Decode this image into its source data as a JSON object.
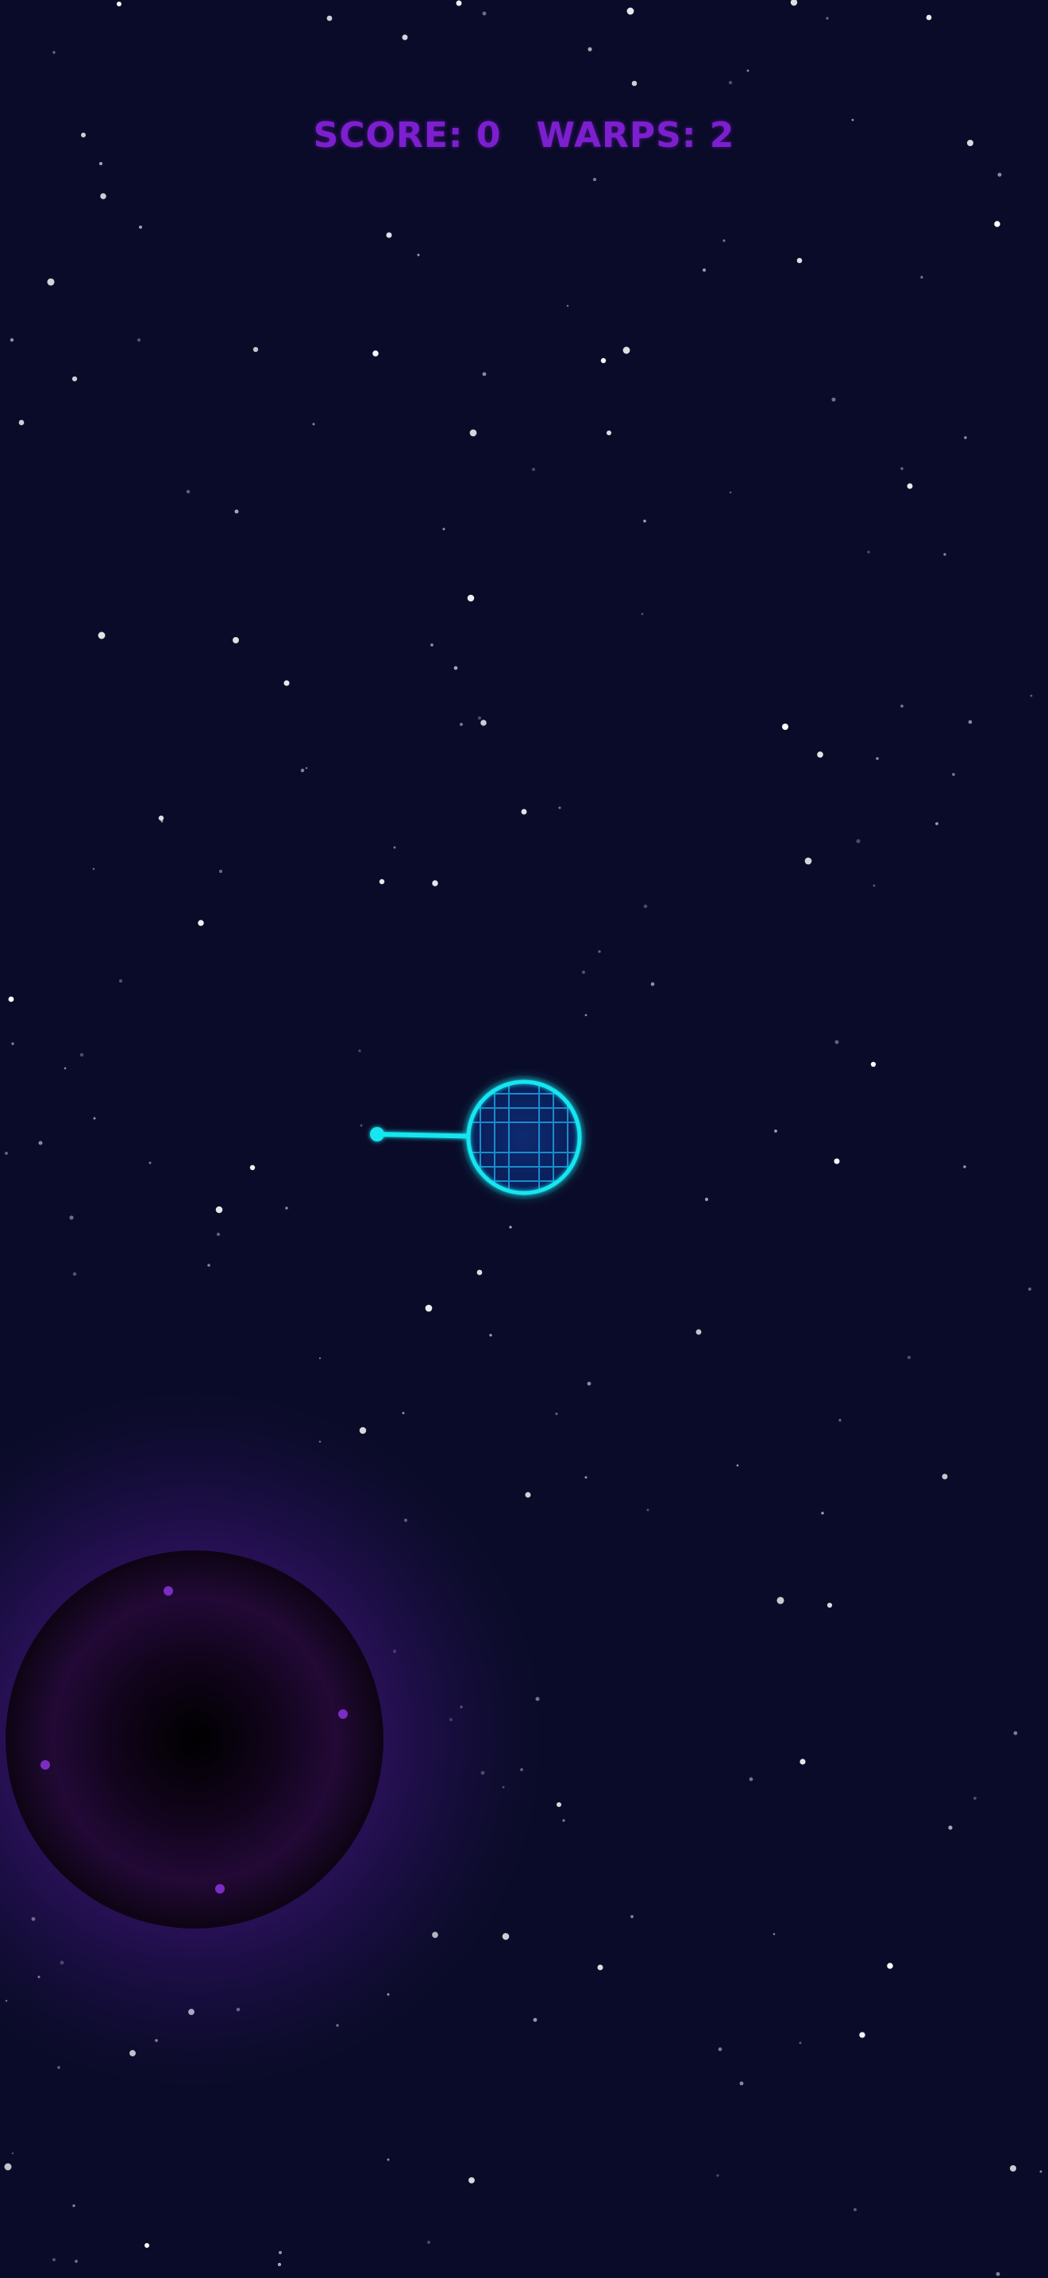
{
  "hud": {
    "score_label": "SCORE:",
    "score_value": "0",
    "warps_label": "WARPS:",
    "warps_value": "2"
  },
  "colors": {
    "background": "#0a0b28",
    "hud_text": "#7d1fcf",
    "player_cyan": "#12e6f0",
    "black_hole_glow": "#5a1a9e",
    "black_hole_particles": "#7a2cc4",
    "star": "#ffffff"
  },
  "entities": {
    "player": {
      "name": "player-orb",
      "icon": "grid-sphere-icon"
    },
    "aim": {
      "name": "aim-line",
      "icon": "aim-line-icon"
    },
    "black_hole": {
      "name": "black-hole",
      "icon": "black-hole-icon"
    }
  }
}
